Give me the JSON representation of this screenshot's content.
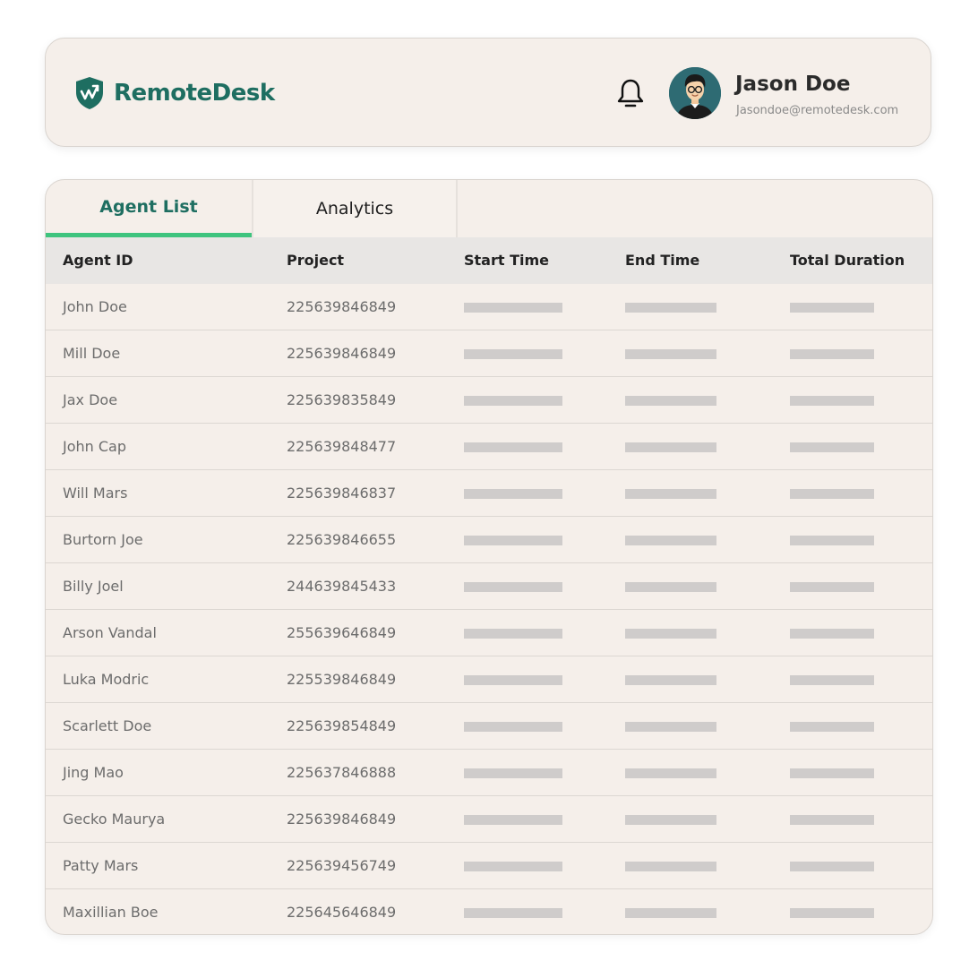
{
  "header": {
    "brand": "RemoteDesk",
    "user": {
      "name": "Jason Doe",
      "email": "Jasondoe@remotedesk.com"
    },
    "icons": {
      "logo": "shield-chart-icon",
      "notification": "bell-icon",
      "avatar": "user-avatar"
    },
    "colors": {
      "brand": "#1e6e61",
      "accent": "#3ec47e",
      "background": "#f5efea"
    }
  },
  "tabs": [
    {
      "label": "Agent List",
      "active": true
    },
    {
      "label": "Analytics",
      "active": false
    }
  ],
  "table": {
    "columns": [
      "Agent ID",
      "Project",
      "Start Time",
      "End Time",
      "Total Duration"
    ],
    "rows": [
      {
        "agent": "John Doe",
        "project": "225639846849"
      },
      {
        "agent": "Mill Doe",
        "project": "225639846849"
      },
      {
        "agent": "Jax Doe",
        "project": "225639835849"
      },
      {
        "agent": "John Cap",
        "project": "225639848477"
      },
      {
        "agent": "Will Mars",
        "project": "225639846837"
      },
      {
        "agent": "Burtorn Joe",
        "project": "225639846655"
      },
      {
        "agent": "Billy Joel",
        "project": "244639845433"
      },
      {
        "agent": "Arson Vandal",
        "project": "255639646849"
      },
      {
        "agent": "Luka Modric",
        "project": "225539846849"
      },
      {
        "agent": "Scarlett Doe",
        "project": "225639854849"
      },
      {
        "agent": "Jing Mao",
        "project": "225637846888"
      },
      {
        "agent": "Gecko Maurya",
        "project": "225639846849"
      },
      {
        "agent": "Patty Mars",
        "project": "225639456749"
      },
      {
        "agent": "Maxillian Boe",
        "project": "225645646849"
      }
    ]
  }
}
